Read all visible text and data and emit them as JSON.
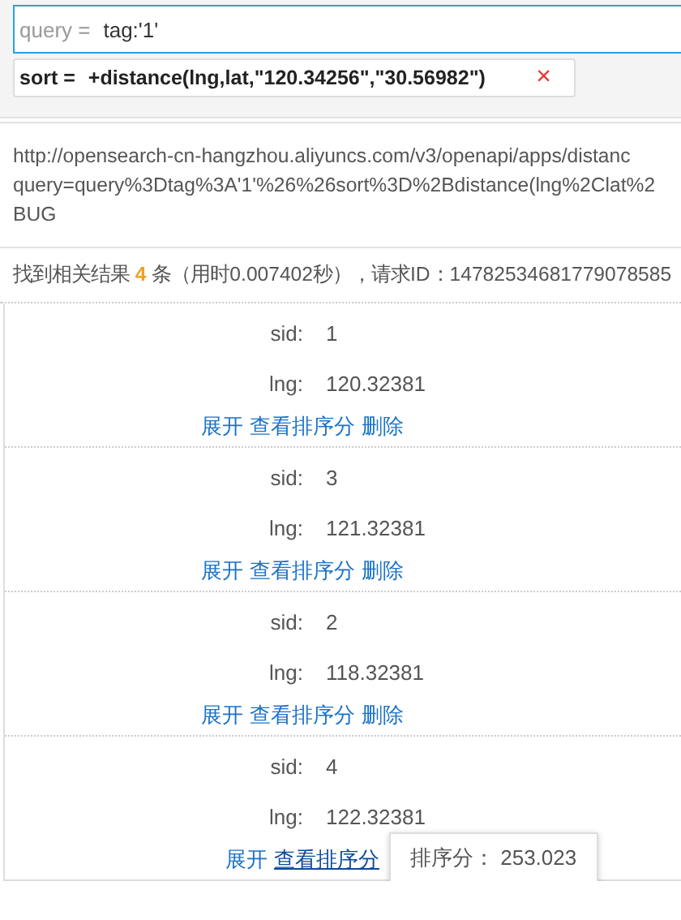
{
  "query_field": {
    "label": "query =",
    "value": "tag:'1'"
  },
  "sort_tag": {
    "label": "sort =",
    "value": "+distance(lng,lat,\"120.34256\",\"30.56982\")",
    "remove": "×"
  },
  "request_url": {
    "lines": [
      "http://opensearch-cn-hangzhou.aliyuncs.com/v3/openapi/apps/distanc",
      "query=query%3Dtag%3A'1'%26%26sort%3D%2Bdistance(lng%2Clat%2",
      "BUG"
    ]
  },
  "summary": {
    "before": "找到相关结果",
    "count": "4",
    "after": "条（用时0.007402秒），请求ID：14782534681779078585"
  },
  "results": [
    {
      "fields": [
        {
          "label": "sid:",
          "value": "1"
        },
        {
          "label": "lng:",
          "value": "120.32381"
        }
      ],
      "actions": [
        {
          "label": "展开",
          "hovered": false
        },
        {
          "label": "查看排序分",
          "hovered": false
        },
        {
          "label": "删除",
          "hovered": false
        }
      ]
    },
    {
      "fields": [
        {
          "label": "sid:",
          "value": "3"
        },
        {
          "label": "lng:",
          "value": "121.32381"
        }
      ],
      "actions": [
        {
          "label": "展开",
          "hovered": false
        },
        {
          "label": "查看排序分",
          "hovered": false
        },
        {
          "label": "删除",
          "hovered": false
        }
      ]
    },
    {
      "fields": [
        {
          "label": "sid:",
          "value": "2"
        },
        {
          "label": "lng:",
          "value": "118.32381"
        }
      ],
      "actions": [
        {
          "label": "展开",
          "hovered": false
        },
        {
          "label": "查看排序分",
          "hovered": false
        },
        {
          "label": "删除",
          "hovered": false
        }
      ]
    },
    {
      "fields": [
        {
          "label": "sid:",
          "value": "4"
        },
        {
          "label": "lng:",
          "value": "122.32381"
        }
      ],
      "actions": [
        {
          "label": "展开",
          "hovered": false
        },
        {
          "label": "查看排序分",
          "hovered": true,
          "tooltip": "排序分： 253.023"
        }
      ]
    }
  ]
}
